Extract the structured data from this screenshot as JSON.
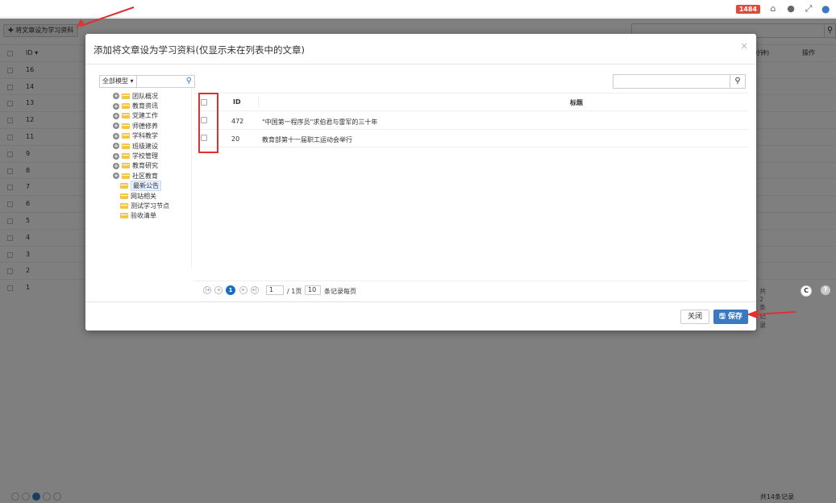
{
  "topbar": {
    "badge": "1484",
    "icons": [
      "home-icon",
      "chat-icon",
      "fullscreen-icon",
      "user-icon"
    ]
  },
  "background": {
    "add_button_label": "✚ 将文章设为学习资料",
    "table_header": {
      "id": "ID ▾",
      "time": "分钟)",
      "operation": "操作"
    },
    "row_ids": [
      "16",
      "14",
      "13",
      "12",
      "11",
      "9",
      "8",
      "7",
      "6",
      "5",
      "4",
      "3",
      "2",
      "1"
    ],
    "pager_status": "共14条记录"
  },
  "modal": {
    "title": "添加将文章设为学习资料(仅显示未在列表中的文章)",
    "close_icon": "×",
    "model_select": "全部模型 ▾",
    "tree": [
      {
        "label": "团队概况",
        "expandable": true
      },
      {
        "label": "教育资讯",
        "expandable": true
      },
      {
        "label": "党建工作",
        "expandable": true
      },
      {
        "label": "师德修养",
        "expandable": true
      },
      {
        "label": "学科教学",
        "expandable": true
      },
      {
        "label": "班级建设",
        "expandable": true
      },
      {
        "label": "学校管理",
        "expandable": true
      },
      {
        "label": "教育研究",
        "expandable": true
      },
      {
        "label": "社区教育",
        "expandable": true
      },
      {
        "label": "最新公告",
        "expandable": false,
        "selected": true
      },
      {
        "label": "网站相关",
        "expandable": false
      },
      {
        "label": "测试学习节点",
        "expandable": false
      },
      {
        "label": "验收清单",
        "expandable": false
      }
    ],
    "grid": {
      "header": {
        "id": "ID",
        "title": "标题"
      },
      "rows": [
        {
          "id": "472",
          "title": "\"中国第一程序员\"求伯君与雷军的三十年"
        },
        {
          "id": "20",
          "title": "教育部第十一届职工运动会举行"
        }
      ]
    },
    "pager": {
      "current_page": "1",
      "page_input": "1",
      "total_pages": "/ 1页",
      "page_size": "10",
      "per_page_label": "条记录每页",
      "record_count": "共2条记录",
      "refresh_icon": "C",
      "help_icon": "?"
    },
    "footer": {
      "close_label": "关闭",
      "save_label": "🖫 保存"
    }
  },
  "colors": {
    "accent": "#3a78c2",
    "highlight": "#e03030",
    "badge": "#e04a3b"
  }
}
